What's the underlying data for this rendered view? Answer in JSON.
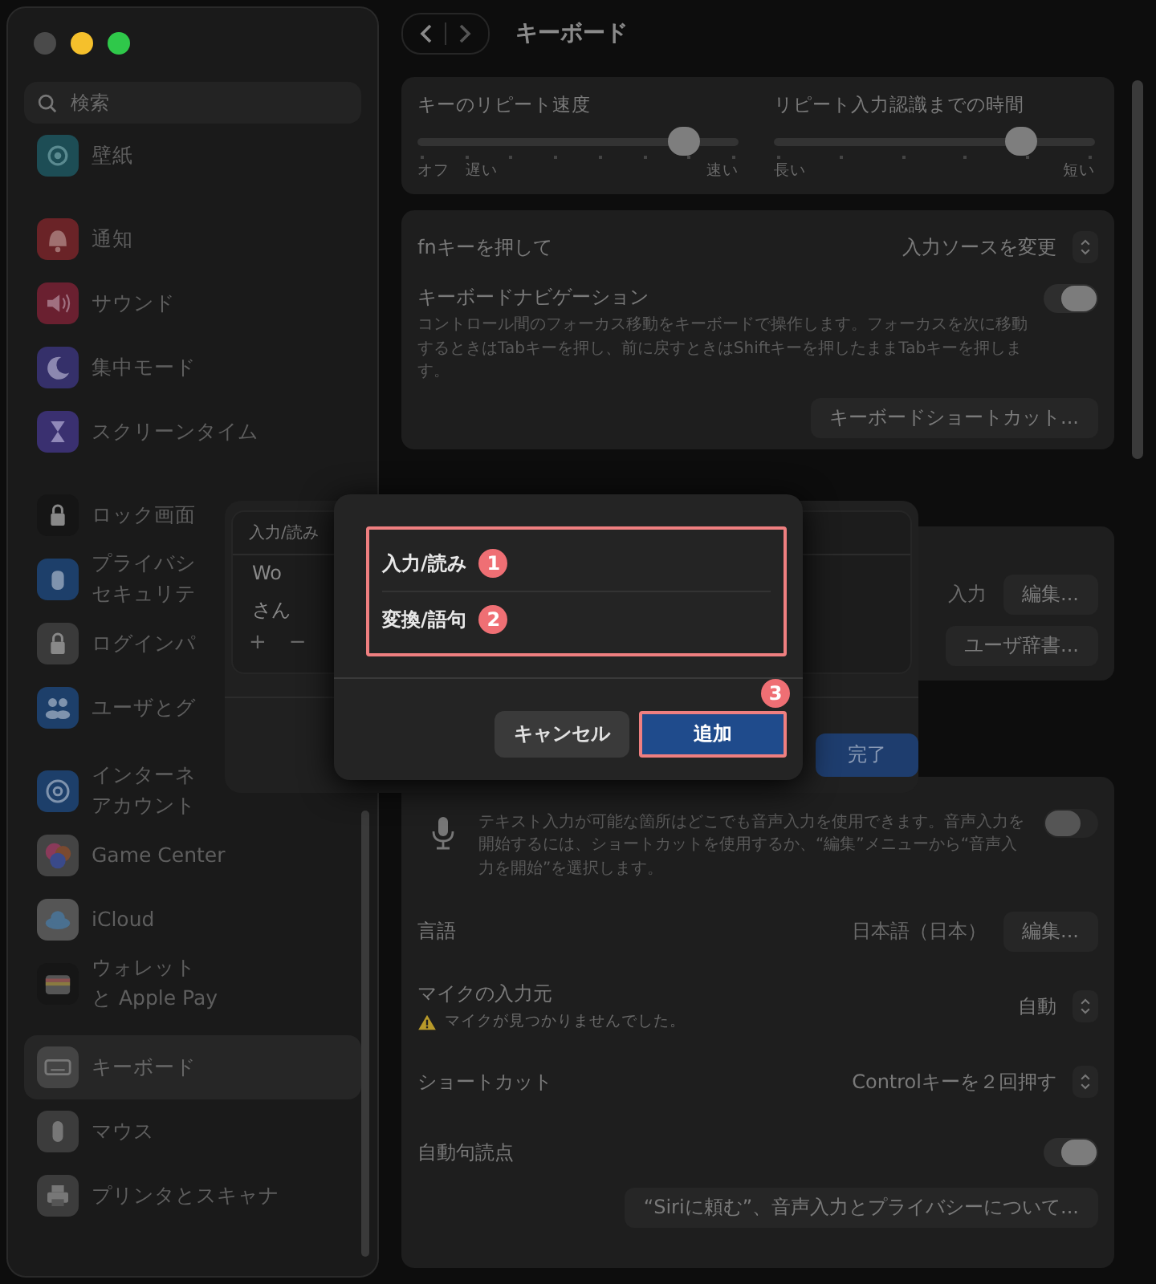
{
  "sidebar": {
    "search": {
      "placeholder": "検索"
    },
    "groups": [
      [
        {
          "label": "壁紙",
          "selected": false
        }
      ],
      [
        {
          "label": "通知",
          "selected": false
        },
        {
          "label": "サウンド",
          "selected": false
        },
        {
          "label": "集中モード",
          "selected": false
        },
        {
          "label": "スクリーンタイム",
          "selected": false
        }
      ],
      [
        {
          "label": "ロック画面",
          "selected": false
        },
        {
          "lines": [
            "プライバシ",
            "セキュリテ"
          ],
          "selected": false
        },
        {
          "label": "ログインパ",
          "selected": false
        },
        {
          "label": "ユーザとグ",
          "selected": false
        }
      ],
      [
        {
          "lines": [
            "インターネ",
            "アカウント"
          ],
          "selected": false
        },
        {
          "label": "Game Center",
          "selected": false
        },
        {
          "label": "iCloud",
          "selected": false
        },
        {
          "lines": [
            "ウォレット",
            "と Apple Pay"
          ],
          "selected": false
        }
      ],
      [
        {
          "label": "キーボード",
          "selected": true
        },
        {
          "label": "マウス",
          "selected": false
        },
        {
          "label": "プリンタとスキャナ",
          "selected": false
        }
      ]
    ]
  },
  "toolbar": {
    "title": "キーボード"
  },
  "sliders": [
    {
      "label": "キーのリピート速度",
      "level": 0.83,
      "min_labels": [
        "オフ",
        "遅い"
      ],
      "max_label": "速い"
    },
    {
      "label": "リピート入力認識までの時間",
      "level": 0.77,
      "min_labels": [
        "長い"
      ],
      "max_label": "短い"
    }
  ],
  "keyboard_card": {
    "fn_label": "fnキーを押して",
    "fn_value": "入力ソースを変更",
    "nav_label": "キーボードナビゲーション",
    "nav_description": "コントロール間のフォーカス移動をキーボードで操作します。フォーカスを次に移動するときはTabキーを押し、前に戻すときはShiftキーを押したままTabキーを押します。",
    "nav_on": true,
    "shortcuts_button": "キーボードショートカット..."
  },
  "text_input_card": {
    "label": "入力",
    "edit_button": "編集...",
    "dictionary_button": "ユーザ辞書..."
  },
  "dictionary_sheet": {
    "column_header": "入力/読み",
    "rows": [
      "Wo",
      "さん"
    ],
    "add": "+",
    "remove": "−",
    "done_button": "完了"
  },
  "add_dialog": {
    "fields": [
      {
        "label": "入力/読み",
        "badge": "1"
      },
      {
        "label": "変換/語句",
        "badge": "2"
      }
    ],
    "cancel_button": "キャンセル",
    "add_button": "追加",
    "add_badge": "3"
  },
  "dictation_card": {
    "description": "テキスト入力が可能な箇所はどこでも音声入力を使用できます。音声入力を開始するには、ショートカットを使用するか、“編集”メニューから“音声入力を開始”を選択します。",
    "on": false,
    "rows": [
      {
        "kind": "value-button",
        "label": "言語",
        "value": "日本語（日本）",
        "button": "編集..."
      },
      {
        "kind": "popup",
        "label": "マイクの入力元",
        "value": "自動",
        "warning": "マイクが見つかりませんでした。"
      },
      {
        "kind": "popup",
        "label": "ショートカット",
        "value": "Controlキーを２回押す"
      },
      {
        "kind": "toggle",
        "label": "自動句読点",
        "on": true
      }
    ],
    "privacy_button": "“Siriに頼む”、音声入力とプライバシーについて..."
  }
}
